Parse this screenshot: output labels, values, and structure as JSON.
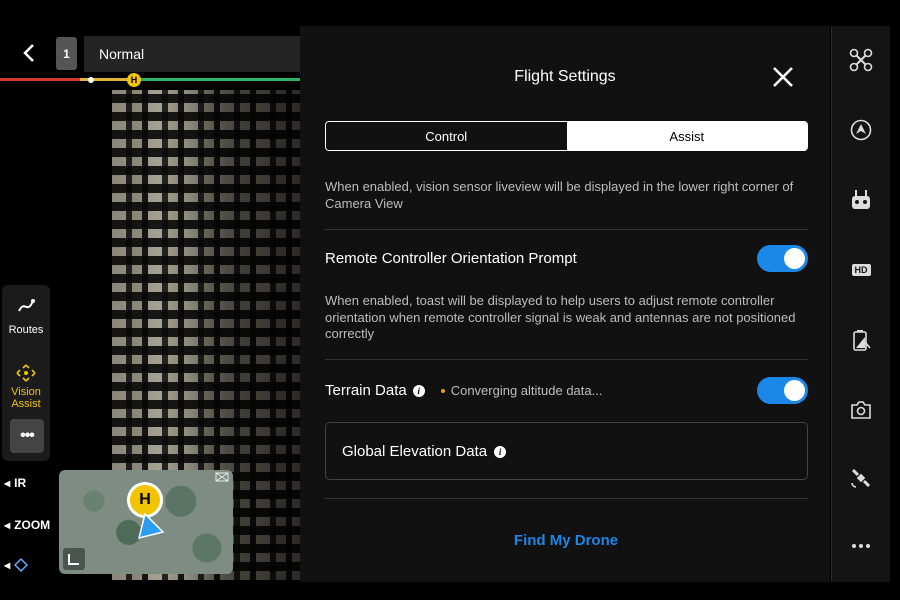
{
  "header": {
    "mode_number": "1",
    "flight_mode": "Normal",
    "battery_home_marker": "H"
  },
  "left_panel": {
    "routes_label": "Routes",
    "vision_assist_label_1": "Vision",
    "vision_assist_label_2": "Assist",
    "more_label": "•••"
  },
  "side_controls": {
    "ir_label": "IR",
    "zoom_label": "ZOOM"
  },
  "minimap": {
    "home_marker": "H",
    "expand_icon": "expand-icon"
  },
  "settings": {
    "title": "Flight Settings",
    "tabs": [
      {
        "label": "Control",
        "active": true
      },
      {
        "label": "Assist",
        "active": false
      }
    ],
    "vision_liveview_desc": "When enabled, vision sensor liveview will be displayed in the lower right corner of Camera View",
    "rc_orientation": {
      "label": "Remote Controller Orientation Prompt",
      "enabled": true,
      "desc": "When enabled, toast will be displayed to help users to adjust remote controller orientation when remote controller signal is weak and antennas are not positioned correctly"
    },
    "terrain_data": {
      "label": "Terrain Data",
      "status": "Converging altitude data...",
      "enabled": true
    },
    "global_elevation": {
      "label": "Global Elevation Data"
    },
    "find_my_drone": "Find My Drone"
  },
  "colors": {
    "accent_blue": "#1b87e6",
    "accent_yellow": "#f2c400",
    "status_orange": "#f29a1c"
  },
  "right_toolbar": [
    "drone-icon",
    "obstacle-icon",
    "remote-controller-icon",
    "hd-icon",
    "battery-icon",
    "camera-icon",
    "satellite-icon",
    "more-icon"
  ],
  "right_toolbar_hd_text": "HD"
}
